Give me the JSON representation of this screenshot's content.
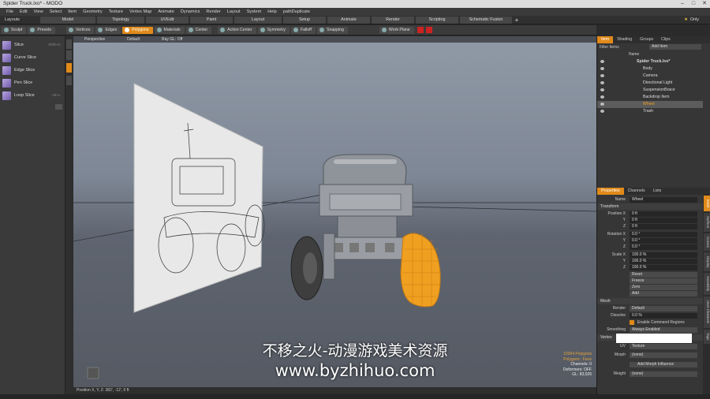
{
  "window": {
    "title": "Spider Truck.lxo* - MODO"
  },
  "menu": [
    "File",
    "Edit",
    "View",
    "Select",
    "Item",
    "Geometry",
    "Texture",
    "Vertex Map",
    "Animate",
    "Dynamics",
    "Render",
    "Layout",
    "System",
    "Help",
    "pathDuplicate"
  ],
  "layout": {
    "label": "Layouts",
    "tabs": [
      "Model",
      "Topology",
      "UVEdit",
      "Paint",
      "Layout",
      "Setup",
      "Animate",
      "Render",
      "Scripting",
      "Schematic Fusion"
    ],
    "add": "+",
    "only": "Only"
  },
  "toolbar": {
    "left": [
      "Sculpt",
      "Presets"
    ],
    "modes": [
      "Vertices",
      "Edges",
      "Polygons",
      "Materials",
      "Center"
    ],
    "tools": [
      "Action Center",
      "Symmetry",
      "Falloff",
      "Snapping",
      "Work Plane"
    ]
  },
  "leftpanel": {
    "items": [
      {
        "label": "Slice",
        "key": "Shift+C"
      },
      {
        "label": "Curve Slice",
        "key": ""
      },
      {
        "label": "Edge Slice",
        "key": ""
      },
      {
        "label": "Pen Slice",
        "key": ""
      },
      {
        "label": "Loop Slice",
        "key": "Alt+L"
      }
    ]
  },
  "viewport": {
    "header": [
      "Perspective",
      "Default",
      "Ray GL: Off"
    ],
    "info": {
      "polys": "10364 Polygons",
      "select": "Polygons : Face",
      "channels": "Channels: 0",
      "deformers": "Deformers: OFF",
      "gl": "GL: 83,026"
    },
    "status": "Position X, Y, Z: 382', -12', 0 ft",
    "watermark": "不移之火-动漫游戏美术资源",
    "watermark_url": "www.byzhihuo.com"
  },
  "items_panel": {
    "tabs": [
      "Item",
      "Shading",
      "Groups",
      "Clips"
    ],
    "filter": "Filter Items",
    "add": "Add Item",
    "col": "Name",
    "tree": [
      {
        "label": "Spider Truck.lxo*",
        "depth": 0
      },
      {
        "label": "Body",
        "depth": 1
      },
      {
        "label": "Camera",
        "depth": 1
      },
      {
        "label": "Directional Light",
        "depth": 1
      },
      {
        "label": "SuspensionBrace",
        "depth": 1
      },
      {
        "label": "Backdrop Item",
        "depth": 1
      },
      {
        "label": "Wheel",
        "depth": 1
      },
      {
        "label": "Trash",
        "depth": 1
      }
    ]
  },
  "properties": {
    "tabs": [
      "Properties",
      "Channels",
      "Lists"
    ],
    "name_label": "Name",
    "name": "Wheel",
    "transform_section": "Transform",
    "position_label": "Position X",
    "position": [
      "0 ft",
      "0 ft",
      "0 ft"
    ],
    "rotation_label": "Rotation X",
    "rotation": [
      "0.0 °",
      "0.0 °",
      "0.0 °"
    ],
    "scale_label": "Scale X",
    "scale": [
      "100.0 %",
      "100.0 %",
      "100.0 %"
    ],
    "y": "Y",
    "z": "Z",
    "buttons": [
      "Reset",
      "Freeze",
      "Zero",
      "Add"
    ],
    "mesh_section": "Mesh",
    "render_label": "Render",
    "render": "Default",
    "dissolve_label": "Dissolve",
    "dissolve": "0.0 %",
    "enable_cmd": "Enable Command Regions",
    "smoothing_label": "Smoothing",
    "smoothing": "Always Enabled",
    "vertex_section": "Vertex",
    "uv_label": "UV",
    "uv": "Texture",
    "morph_label": "Morph",
    "morph": "(none)",
    "add_morph": "Add Morph Influence",
    "weight_label": "Weight",
    "weight": "(none)"
  },
  "side_tabs": [
    "Mesh",
    "Surface",
    "Curves",
    "Display",
    "Assembly",
    "User Channels",
    "Tags"
  ],
  "colors": {
    "accent": "#e08a1a",
    "wheel_selected": "#f0a020"
  }
}
